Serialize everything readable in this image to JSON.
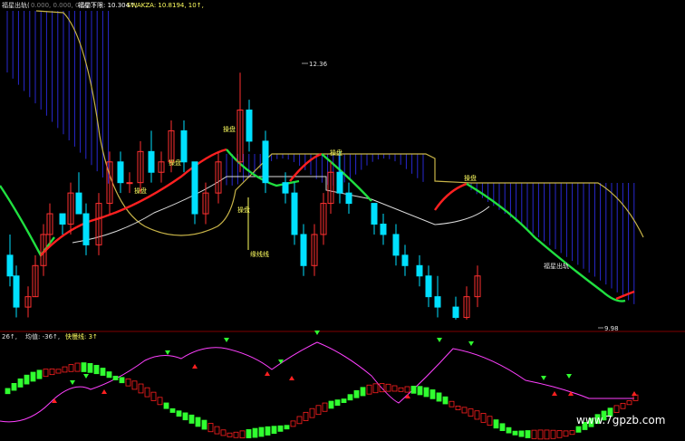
{
  "header": {
    "main_indicator": "福星出轨(",
    "main_params": "0.000, 0.000, 0.000)",
    "sub1_label": "福星下限: 10.304↑,",
    "sub2_label": "SWAKZA: 10.8194, 10↑,"
  },
  "lower_header": {
    "value_label": "26↑,",
    "avg_label": "均值: -36↑,",
    "signal_label": "快慢线: 3↑"
  },
  "annotations": {
    "high": "12.36",
    "low": "9.98",
    "label_a": "操盘",
    "label_b": "操盘",
    "label_c": "操盘",
    "label_d": "操盘",
    "label_e": "操盘",
    "label_f": "操盘",
    "label_g": "缘线线",
    "label_h": "福星出轨"
  },
  "watermark": "www.7gpzb.com",
  "colors": {
    "up": "#ff3030",
    "down": "#00e0ff",
    "green_line": "#20e040",
    "red_line": "#ff2020",
    "yellow_line": "#c8b448",
    "white_line": "#dcdcdc",
    "blue_bars": "#2828d0",
    "magenta": "#ff40ff",
    "green_bars": "#30ff30"
  },
  "chart_data": {
    "type": "candlestick",
    "ylim": [
      9.9,
      12.45
    ],
    "candles": [
      [
        10.6,
        10.8,
        10.3,
        10.4
      ],
      [
        10.4,
        10.5,
        10.0,
        10.1
      ],
      [
        10.1,
        10.3,
        10.0,
        10.2
      ],
      [
        10.2,
        10.6,
        10.2,
        10.5
      ],
      [
        10.5,
        10.9,
        10.4,
        10.8
      ],
      [
        10.8,
        11.1,
        10.7,
        11.0
      ],
      [
        11.0,
        11.0,
        10.8,
        10.9
      ],
      [
        10.9,
        11.3,
        10.8,
        11.2
      ],
      [
        11.2,
        11.4,
        11.0,
        11.0
      ],
      [
        11.0,
        11.1,
        10.6,
        10.7
      ],
      [
        10.7,
        11.2,
        10.6,
        11.1
      ],
      [
        11.1,
        11.6,
        11.0,
        11.5
      ],
      [
        11.5,
        11.6,
        11.2,
        11.3
      ],
      [
        11.3,
        11.4,
        11.2,
        11.3
      ],
      [
        11.3,
        11.7,
        11.2,
        11.6
      ],
      [
        11.6,
        11.8,
        11.3,
        11.4
      ],
      [
        11.4,
        11.6,
        11.3,
        11.5
      ],
      [
        11.5,
        11.9,
        11.4,
        11.8
      ],
      [
        11.8,
        11.9,
        11.4,
        11.5
      ],
      [
        11.5,
        11.5,
        10.9,
        11.0
      ],
      [
        11.0,
        11.3,
        10.9,
        11.2
      ],
      [
        11.2,
        11.6,
        11.1,
        11.5
      ],
      [
        11.5,
        12.36,
        11.4,
        12.0
      ],
      [
        12.0,
        12.1,
        11.6,
        11.7
      ],
      [
        11.7,
        11.8,
        11.2,
        11.3
      ],
      [
        11.3,
        11.4,
        11.1,
        11.2
      ],
      [
        11.2,
        11.3,
        10.7,
        10.8
      ],
      [
        10.8,
        10.9,
        10.4,
        10.5
      ],
      [
        10.5,
        10.9,
        10.4,
        10.8
      ],
      [
        10.8,
        11.2,
        10.7,
        11.1
      ],
      [
        11.1,
        11.5,
        11.0,
        11.4
      ],
      [
        11.4,
        11.6,
        11.1,
        11.2
      ],
      [
        11.2,
        11.3,
        11.0,
        11.1
      ],
      [
        11.1,
        11.1,
        10.8,
        10.9
      ],
      [
        10.9,
        11.0,
        10.7,
        10.8
      ],
      [
        10.8,
        10.9,
        10.5,
        10.6
      ],
      [
        10.6,
        10.7,
        10.4,
        10.5
      ],
      [
        10.5,
        10.6,
        10.3,
        10.4
      ],
      [
        10.4,
        10.5,
        10.1,
        10.2
      ],
      [
        10.2,
        10.4,
        10.0,
        10.1
      ],
      [
        10.1,
        10.2,
        9.98,
        10.0
      ],
      [
        10.0,
        10.3,
        9.98,
        10.2
      ],
      [
        10.2,
        10.5,
        10.1,
        10.4
      ]
    ],
    "series": [
      {
        "name": "福星下限",
        "values": [
          10.3,
          10.5,
          10.7,
          10.9,
          11.0,
          11.1,
          11.2,
          11.3,
          11.4,
          11.5,
          11.6,
          11.6,
          11.6,
          11.4,
          11.2,
          11.0,
          10.9,
          10.8,
          10.7,
          10.5,
          10.4,
          10.3,
          10.2,
          10.1,
          10.0
        ]
      },
      {
        "name": "SWAKZA",
        "values": [
          10.8,
          10.75,
          10.9,
          11.2,
          11.6,
          11.8,
          11.7,
          11.5,
          11.3,
          11.0,
          10.8,
          10.6,
          10.4,
          10.3,
          10.2,
          10.15,
          10.1,
          10.05,
          10.0,
          10.0,
          10.02
        ]
      }
    ]
  }
}
